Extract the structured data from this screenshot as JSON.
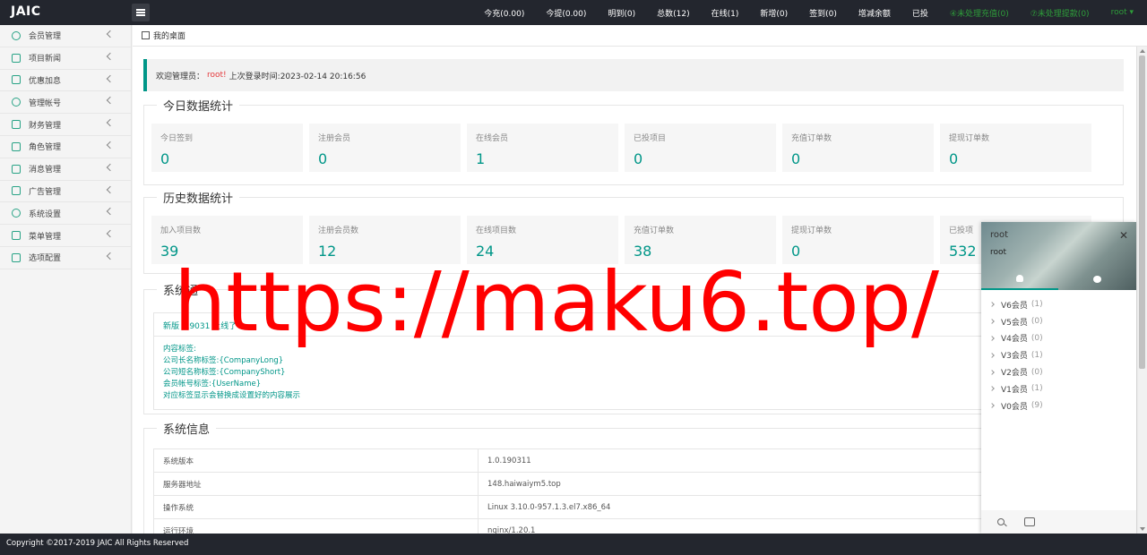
{
  "app": {
    "title": "JAIC"
  },
  "topnav": [
    {
      "label": "今充(0.00)",
      "color": "#ffffff"
    },
    {
      "label": "今提(0.00)",
      "color": "#ffffff"
    },
    {
      "label": "明到(0)",
      "color": "#ffffff"
    },
    {
      "label": "总数(12)",
      "color": "#ffffff"
    },
    {
      "label": "在线(1)",
      "color": "#ffffff"
    },
    {
      "label": "新增(0)",
      "color": "#ffffff"
    },
    {
      "label": "签到(0)",
      "color": "#ffffff"
    },
    {
      "label": "增减余额",
      "color": "#ffffff"
    },
    {
      "label": "已投",
      "color": "#ffffff"
    },
    {
      "label": "④未处理充值(0)",
      "color": "#2e9d3a"
    },
    {
      "label": "⑦未处理提款(0)",
      "color": "#2e9d3a"
    },
    {
      "label": "root ▾",
      "color": "#2e9d3a"
    }
  ],
  "sidebar": [
    {
      "label": "会员管理",
      "icon": "user-icon"
    },
    {
      "label": "项目新闻",
      "icon": "book-icon"
    },
    {
      "label": "优惠加息",
      "icon": "image-icon"
    },
    {
      "label": "管理帐号",
      "icon": "user-admin-icon"
    },
    {
      "label": "财务管理",
      "icon": "money-icon"
    },
    {
      "label": "角色管理",
      "icon": "shield-icon"
    },
    {
      "label": "消息管理",
      "icon": "message-icon"
    },
    {
      "label": "广告管理",
      "icon": "picture-icon"
    },
    {
      "label": "系统设置",
      "icon": "gear-icon"
    },
    {
      "label": "菜单管理",
      "icon": "menu-icon"
    },
    {
      "label": "选项配置",
      "icon": "config-icon"
    }
  ],
  "tabs": {
    "home": "我的桌面"
  },
  "welcome": {
    "prefix": "欢迎管理员：",
    "user": "root!",
    "suffix": "上次登录时间:2023-02-14 20:16:56"
  },
  "today": {
    "title": "今日数据统计",
    "stats": [
      {
        "label": "今日签到",
        "value": "0"
      },
      {
        "label": "注册会员",
        "value": "0"
      },
      {
        "label": "在线会员",
        "value": "1"
      },
      {
        "label": "已投项目",
        "value": "0"
      },
      {
        "label": "充值订单数",
        "value": "0"
      },
      {
        "label": "提现订单数",
        "value": "0"
      }
    ]
  },
  "history": {
    "title": "历史数据统计",
    "stats": [
      {
        "label": "加入项目数",
        "value": "39"
      },
      {
        "label": "注册会员数",
        "value": "12"
      },
      {
        "label": "在线项目数",
        "value": "24"
      },
      {
        "label": "充值订单数",
        "value": "38"
      },
      {
        "label": "提现订单数",
        "value": "0"
      },
      {
        "label": "已投项",
        "value": "532"
      }
    ]
  },
  "notice": {
    "title": "系统通",
    "head": "新版 .19031 上线了",
    "lines": [
      "内容标签:",
      "公司长名称标签:{CompanyLong}",
      "公司短名称标签:{CompanyShort}",
      "会员帐号标签:{UserName}",
      "对应标签显示会替换成设置好的内容展示"
    ]
  },
  "sysinfo": {
    "title": "系统信息",
    "rows": [
      {
        "k": "系统版本",
        "v": "1.0.190311"
      },
      {
        "k": "服务器地址",
        "v": "148.haiwaiym5.top"
      },
      {
        "k": "操作系统",
        "v": "Linux 3.10.0-957.1.3.el7.x86_64"
      },
      {
        "k": "运行环境",
        "v": "nginx/1.20.1"
      }
    ]
  },
  "chat": {
    "username": "root",
    "sign": "root",
    "close": "✕",
    "groups": [
      {
        "name": "V6会员",
        "count": "(1)"
      },
      {
        "name": "V5会员",
        "count": "(0)"
      },
      {
        "name": "V4会员",
        "count": "(0)"
      },
      {
        "name": "V3会员",
        "count": "(1)"
      },
      {
        "name": "V2会员",
        "count": "(0)"
      },
      {
        "name": "V1会员",
        "count": "(1)"
      },
      {
        "name": "V0会员",
        "count": "(9)"
      }
    ]
  },
  "footer": {
    "text": "Copyright ©2017-2019 JAIC All Rights Reserved"
  },
  "watermark": {
    "text": "https://maku6.top/"
  },
  "colors": {
    "accent": "#009688",
    "topbar": "#23262e",
    "watermark": "#ff0000"
  }
}
